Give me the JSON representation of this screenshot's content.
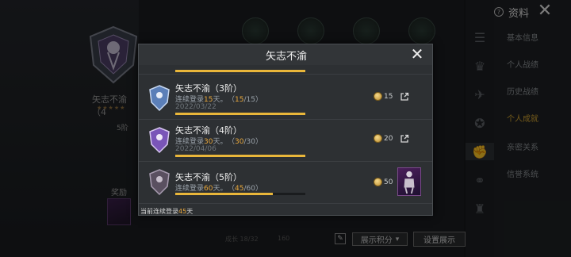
{
  "background": {
    "achievement_name": "矢志不渝（4",
    "stars": "★★★★★",
    "count": "5阶",
    "reward_label": "奖励",
    "meta_left": "成长 18/32",
    "meta_right": "160",
    "display_points_label": "展示积分",
    "display_settings_label": "设置展示"
  },
  "sidebar": {
    "title": "资料",
    "items": [
      {
        "label": "基本信息"
      },
      {
        "label": "个人战绩"
      },
      {
        "label": "历史战绩"
      },
      {
        "label": "个人成就"
      },
      {
        "label": "亲密关系"
      },
      {
        "label": "信誉系统"
      }
    ],
    "active_index": 3
  },
  "colors": {
    "accent_gold": "#e9b63a",
    "highlight_orange": "#e8a73c",
    "panel_bg": "#2d3033"
  },
  "modal": {
    "title": "矢志不渝",
    "rows": [
      {
        "title": "矢志不渝（3阶）",
        "streak_prefix": "连续登录",
        "streak_days": "15",
        "streak_suffix": "天。",
        "progress_open": "（",
        "progress_done": "15",
        "progress_total": "/15）",
        "date": "2022/03/22",
        "progress_fraction": 1.0,
        "points": "15",
        "emblem_tier": "blue"
      },
      {
        "title": "矢志不渝（4阶）",
        "streak_prefix": "连续登录",
        "streak_days": "30",
        "streak_suffix": "天。",
        "progress_open": "（",
        "progress_done": "30",
        "progress_total": "/30）",
        "date": "2022/04/06",
        "progress_fraction": 1.0,
        "points": "20",
        "emblem_tier": "purple"
      },
      {
        "title": "矢志不渝（5阶）",
        "streak_prefix": "连续登录",
        "streak_days": "60",
        "streak_suffix": "天。",
        "progress_open": "（",
        "progress_done": "45",
        "progress_total": "/60）",
        "date": "",
        "progress_fraction": 0.75,
        "points": "50",
        "emblem_tier": "grey"
      }
    ],
    "footer_prefix": "当前连续登录",
    "footer_days": "45",
    "footer_suffix": "天"
  }
}
